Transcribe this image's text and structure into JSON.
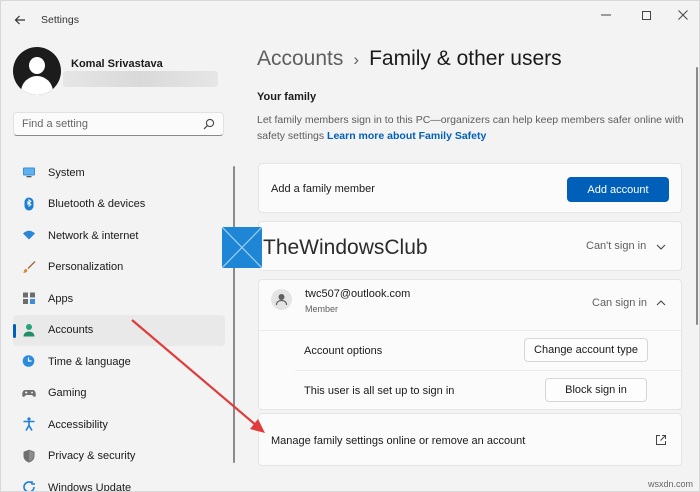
{
  "window": {
    "title": "Settings"
  },
  "user": {
    "name": "Komal Srivastava"
  },
  "search": {
    "placeholder": "Find a setting"
  },
  "nav": {
    "items": [
      {
        "label": "System",
        "icon": "monitor-icon",
        "active": false
      },
      {
        "label": "Bluetooth & devices",
        "icon": "bluetooth-icon",
        "active": false
      },
      {
        "label": "Network & internet",
        "icon": "wifi-icon",
        "active": false
      },
      {
        "label": "Personalization",
        "icon": "brush-icon",
        "active": false
      },
      {
        "label": "Apps",
        "icon": "apps-icon",
        "active": false
      },
      {
        "label": "Accounts",
        "icon": "person-icon",
        "active": true
      },
      {
        "label": "Time & language",
        "icon": "globe-clock-icon",
        "active": false
      },
      {
        "label": "Gaming",
        "icon": "gamepad-icon",
        "active": false
      },
      {
        "label": "Accessibility",
        "icon": "accessibility-icon",
        "active": false
      },
      {
        "label": "Privacy & security",
        "icon": "shield-icon",
        "active": false
      },
      {
        "label": "Windows Update",
        "icon": "update-icon",
        "active": false
      }
    ]
  },
  "breadcrumb": {
    "parent": "Accounts",
    "separator": "›",
    "current": "Family & other users"
  },
  "family": {
    "title": "Your family",
    "description": "Let family members sign in to this PC—organizers can help keep members safer online with safety settings",
    "link": "Learn more about Family Safety",
    "add_member_label": "Add a family member",
    "add_account_button": "Add account",
    "hidden_member_status": "Can't sign in",
    "member": {
      "email": "twc507@outlook.com",
      "role": "Member",
      "status": "Can sign in",
      "account_options_label": "Account options",
      "change_type_button": "Change account type",
      "signin_note": "This user is all set up to sign in",
      "block_button": "Block sign in"
    },
    "manage_label": "Manage family settings online or remove an account"
  },
  "watermark": {
    "text": "TheWindowsClub"
  },
  "site": {
    "text": "wsxdn.com"
  },
  "colors": {
    "accent": "#005fb8",
    "arrow": "#e03c3c",
    "background": "#f3f3f3"
  }
}
